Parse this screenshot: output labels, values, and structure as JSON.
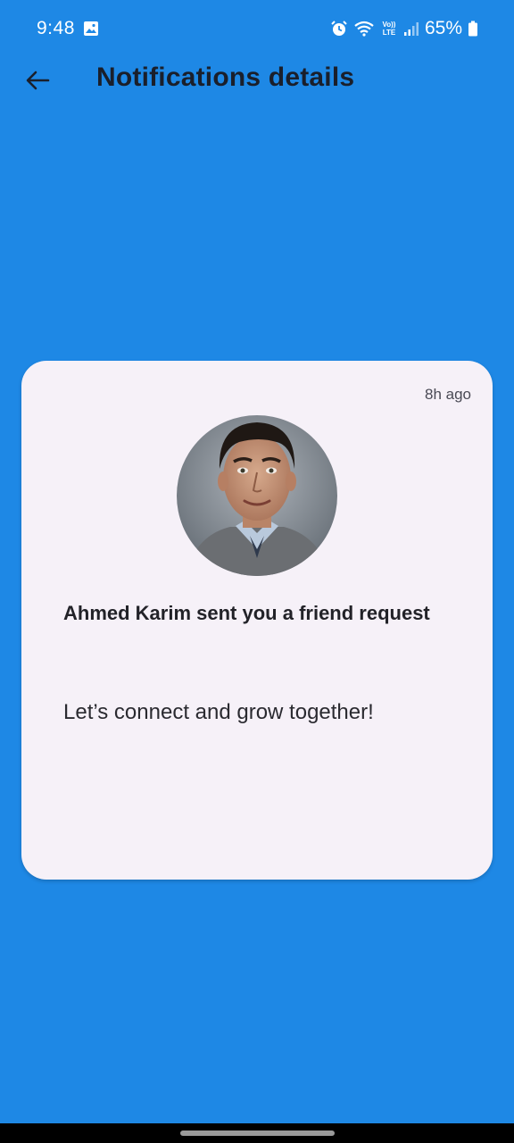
{
  "status_bar": {
    "time": "9:48",
    "battery": "65%",
    "icons": [
      "gallery-icon",
      "alarm-icon",
      "wifi-icon",
      "volte-icon",
      "signal-icon",
      "battery-icon"
    ]
  },
  "app_bar": {
    "back_icon": "arrow-back-icon",
    "title": "Notifications details"
  },
  "notification": {
    "time_ago": "8h ago",
    "title": "Ahmed Karim sent you a friend request",
    "body": "Let’s connect and grow together!"
  },
  "colors": {
    "background": "#1e88e5",
    "card": "#f6f1f8",
    "title_text": "#1a1f2b"
  }
}
